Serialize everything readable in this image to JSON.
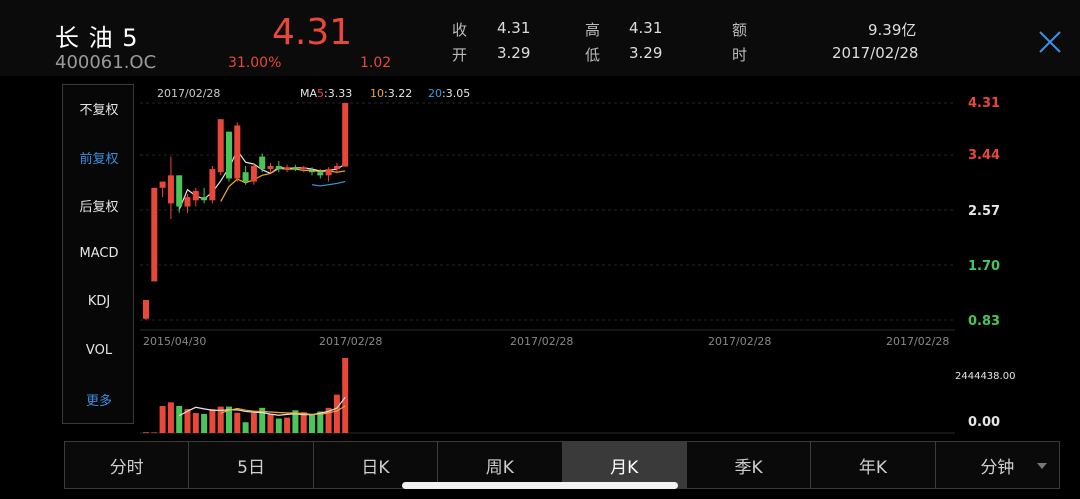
{
  "header": {
    "name": "长 油 5",
    "code": "400061.OC",
    "price": "4.31",
    "change_pct": "31.00%",
    "change": "1.02",
    "quotes": [
      {
        "label": "收",
        "value": "4.31"
      },
      {
        "label": "高",
        "value": "4.31"
      },
      {
        "label": "额",
        "value": "9.39亿"
      },
      {
        "label": "开",
        "value": "3.29"
      },
      {
        "label": "低",
        "value": "3.29"
      },
      {
        "label": "时",
        "value": "2017/02/28"
      }
    ]
  },
  "left_panel": {
    "items": [
      {
        "label": "不复权",
        "active": false
      },
      {
        "label": "前复权",
        "active": true
      },
      {
        "label": "后复权",
        "active": false
      },
      {
        "label": "MACD",
        "active": false
      },
      {
        "label": "KDJ",
        "active": false
      },
      {
        "label": "VOL",
        "active": false
      },
      {
        "label": "更多",
        "active": true
      }
    ]
  },
  "legend": {
    "date": "2017/02/28",
    "ma5_prefix": "MA",
    "ma5_key": "5",
    "ma5_value": ":3.33",
    "ma10_key": "10",
    "ma10_value": ":3.22",
    "ma20_key": "20",
    "ma20_value": ":3.05"
  },
  "price_axis": [
    "4.31",
    "3.44",
    "2.57",
    "1.70",
    "0.83"
  ],
  "date_axis": [
    "2015/04/30",
    "2017/02/28",
    "2017/02/28",
    "2017/02/28",
    "2017/02/28"
  ],
  "volume_axis": [
    "2444438.00",
    "0.00"
  ],
  "tabs": [
    {
      "label": "分时",
      "active": false
    },
    {
      "label": "5日",
      "active": false
    },
    {
      "label": "日K",
      "active": false
    },
    {
      "label": "周K",
      "active": false
    },
    {
      "label": "月K",
      "active": true
    },
    {
      "label": "季K",
      "active": false
    },
    {
      "label": "年K",
      "active": false
    },
    {
      "label": "分钟",
      "active": false,
      "dropdown": true
    }
  ],
  "colors": {
    "up": "#e8483a",
    "down": "#49c55a",
    "ma5": "#e6e6e6",
    "ma10": "#f0a830",
    "ma20": "#3d9be0",
    "accent": "#3d8fe0"
  },
  "chart_data": {
    "type": "candlestick",
    "ylim": [
      0.83,
      4.31
    ],
    "candles": [
      {
        "o": 0.85,
        "h": 1.15,
        "l": 0.83,
        "c": 1.15
      },
      {
        "o": 1.45,
        "h": 2.95,
        "l": 1.45,
        "c": 2.95
      },
      {
        "o": 2.95,
        "h": 3.05,
        "l": 2.8,
        "c": 3.05
      },
      {
        "o": 2.7,
        "h": 3.45,
        "l": 2.45,
        "c": 3.15
      },
      {
        "o": 3.15,
        "h": 3.15,
        "l": 2.55,
        "c": 2.65
      },
      {
        "o": 2.65,
        "h": 2.85,
        "l": 2.55,
        "c": 2.8
      },
      {
        "o": 2.75,
        "h": 2.95,
        "l": 2.65,
        "c": 2.9
      },
      {
        "o": 2.8,
        "h": 2.95,
        "l": 2.7,
        "c": 2.75
      },
      {
        "o": 2.75,
        "h": 3.3,
        "l": 2.7,
        "c": 3.25
      },
      {
        "o": 3.2,
        "h": 4.05,
        "l": 3.15,
        "c": 4.05
      },
      {
        "o": 3.85,
        "h": 3.85,
        "l": 3.05,
        "c": 3.1
      },
      {
        "o": 3.1,
        "h": 4.0,
        "l": 3.05,
        "c": 3.95
      },
      {
        "o": 3.2,
        "h": 3.3,
        "l": 3.0,
        "c": 3.05
      },
      {
        "o": 3.05,
        "h": 3.35,
        "l": 3.0,
        "c": 3.3
      },
      {
        "o": 3.45,
        "h": 3.5,
        "l": 3.2,
        "c": 3.25
      },
      {
        "o": 3.25,
        "h": 3.35,
        "l": 3.2,
        "c": 3.3
      },
      {
        "o": 3.3,
        "h": 3.38,
        "l": 3.2,
        "c": 3.25
      },
      {
        "o": 3.25,
        "h": 3.32,
        "l": 3.2,
        "c": 3.28
      },
      {
        "o": 3.27,
        "h": 3.32,
        "l": 3.22,
        "c": 3.25
      },
      {
        "o": 3.25,
        "h": 3.3,
        "l": 3.2,
        "c": 3.28
      },
      {
        "o": 3.22,
        "h": 3.28,
        "l": 3.15,
        "c": 3.2
      },
      {
        "o": 3.2,
        "h": 3.25,
        "l": 3.1,
        "c": 3.15
      },
      {
        "o": 3.15,
        "h": 3.28,
        "l": 3.05,
        "c": 3.25
      },
      {
        "o": 3.25,
        "h": 3.35,
        "l": 3.18,
        "c": 3.3
      },
      {
        "o": 3.29,
        "h": 4.31,
        "l": 3.29,
        "c": 4.31
      }
    ],
    "ma5": [
      null,
      null,
      null,
      null,
      2.6,
      2.92,
      2.82,
      2.77,
      2.88,
      3.06,
      3.27,
      3.55,
      3.36,
      3.33,
      3.24,
      3.18,
      3.28,
      3.26,
      3.27,
      3.27,
      3.25,
      3.22,
      3.23,
      3.25,
      3.33
    ],
    "ma10": [
      null,
      null,
      null,
      null,
      null,
      null,
      null,
      null,
      null,
      2.73,
      2.97,
      3.09,
      3.03,
      3.08,
      3.15,
      3.18,
      3.26,
      3.25,
      3.25,
      3.23,
      3.23,
      3.21,
      3.22,
      3.2,
      3.22
    ],
    "ma20": [
      null,
      null,
      null,
      null,
      null,
      null,
      null,
      null,
      null,
      null,
      null,
      null,
      null,
      null,
      null,
      null,
      null,
      null,
      null,
      null,
      3.0,
      2.98,
      3.0,
      3.02,
      3.05
    ],
    "volume_max": 2444438,
    "volumes": [
      25000,
      20000,
      880000,
      1000000,
      880000,
      780000,
      650000,
      620000,
      780000,
      860000,
      860000,
      660000,
      350000,
      650000,
      820000,
      600000,
      470000,
      500000,
      740000,
      680000,
      600000,
      700000,
      820000,
      1250000,
      2444438
    ]
  }
}
